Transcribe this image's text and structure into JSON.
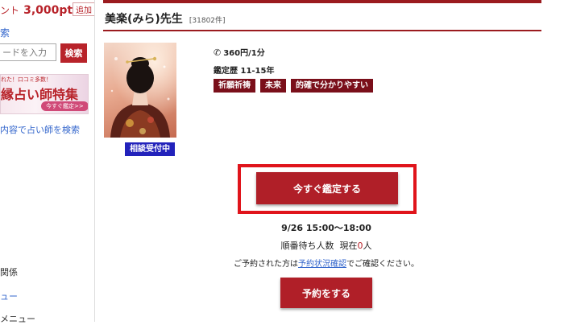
{
  "sidebar": {
    "points_label": "ント",
    "points_value": "3,000pt",
    "add_label": "追加",
    "search_title": "索",
    "search_placeholder": "ードを入力",
    "search_button": "検索",
    "banner": {
      "small_text": "れた！口コミ多数！",
      "main_text": "縁占い師特集",
      "button_text": "今すぐ鑑定>>"
    },
    "content_search_link": "内容で占い師を検索",
    "relation_text": "関係",
    "menu_link": "ュー",
    "menu_text": "メニュー"
  },
  "profile": {
    "name": "美楽(みら)先生",
    "review_count": "[31802件]",
    "status": "相談受付中",
    "price": "360円/1分",
    "experience": "鑑定歴 11-15年",
    "tags": [
      "祈願祈祷",
      "未来",
      "的確で分かりやすい"
    ]
  },
  "actions": {
    "consult_now": "今すぐ鑑定する",
    "reserve": "予約をする"
  },
  "schedule": {
    "time": "9/26 15:00〜18:00",
    "queue_label": "順番待ち人数",
    "queue_current_label": "現在",
    "queue_count": "0",
    "queue_unit": "人",
    "note_prefix": "ご予約された方は",
    "note_link": "予約状況確認",
    "note_suffix": "でご確認ください。"
  },
  "colors": {
    "accent": "#b01f28",
    "dark_red": "#9b1b1f",
    "tag_bg": "#7a0f1a",
    "status_blue": "#2222bb",
    "highlight": "#e0141b",
    "link": "#3366cc"
  }
}
